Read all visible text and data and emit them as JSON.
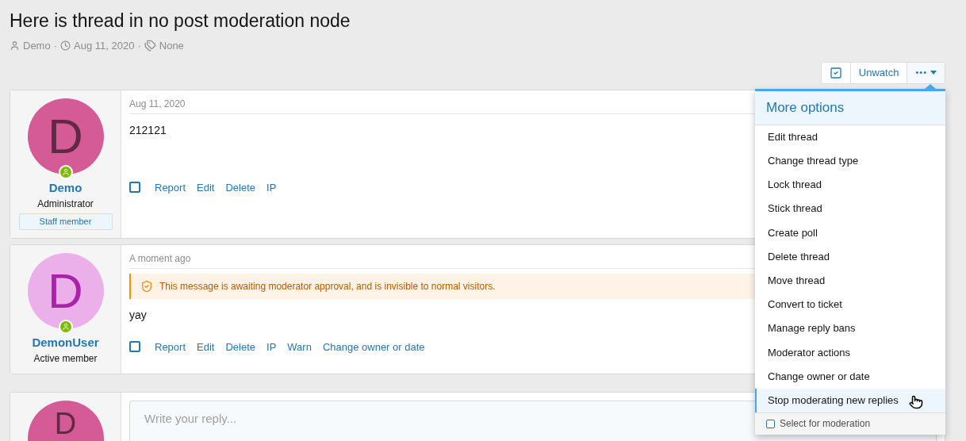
{
  "thread": {
    "title": "Here is thread in no post moderation node",
    "author": "Demo",
    "date": "Aug 11, 2020",
    "tags": "None",
    "separators": [
      "·",
      "·"
    ]
  },
  "toolbar": {
    "watch_label": "Unwatch",
    "more_label": "•••"
  },
  "posts": [
    {
      "username": "Demo",
      "initial": "D",
      "color": "#d55b96",
      "title": "Administrator",
      "badge": "Staff member",
      "date": "Aug 11, 2020",
      "body": "212121",
      "checked": false,
      "actions": [
        "Report",
        "Edit",
        "Delete",
        "IP"
      ]
    },
    {
      "username": "DemonUser",
      "initial": "D",
      "color": "#ebb0ea",
      "title": "Active member",
      "date": "A moment ago",
      "notice": "This message is awaiting moderator approval, and is invisible to normal visitors.",
      "body": "yay",
      "checked": false,
      "actions": [
        "Report",
        "Edit",
        "Delete",
        "IP",
        "Warn",
        "Change owner or date"
      ]
    }
  ],
  "reply": {
    "initial": "D",
    "color": "#d55b96",
    "placeholder": "Write your reply..."
  },
  "menu": {
    "title": "More options",
    "items": [
      {
        "label": "Edit thread",
        "selected": false
      },
      {
        "label": "Change thread type",
        "selected": false
      },
      {
        "label": "Lock thread",
        "selected": false
      },
      {
        "label": "Stick thread",
        "selected": false
      },
      {
        "label": "Create poll",
        "selected": false
      },
      {
        "label": "Delete thread",
        "selected": false
      },
      {
        "label": "Move thread",
        "selected": false
      },
      {
        "label": "Convert to ticket",
        "selected": false
      },
      {
        "label": "Manage reply bans",
        "selected": false
      },
      {
        "label": "Moderator actions",
        "selected": false
      },
      {
        "label": "Change owner or date",
        "selected": false
      },
      {
        "label": "Stop moderating new replies",
        "selected": true
      }
    ],
    "footer": {
      "label": "Select for moderation",
      "checked": false
    }
  }
}
